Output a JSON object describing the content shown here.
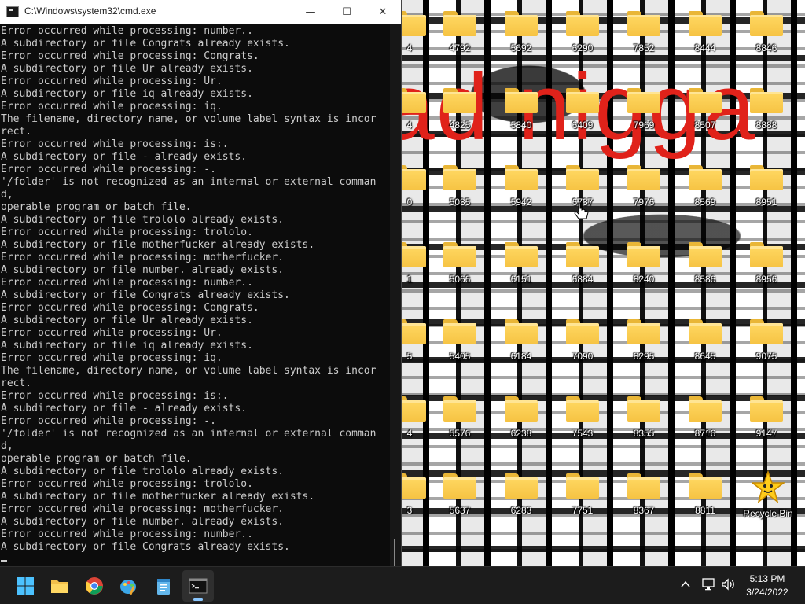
{
  "cmd_window": {
    "title": "C:\\Windows\\system32\\cmd.exe",
    "minimize_symbol": "—",
    "maximize_symbol": "☐",
    "close_symbol": "✕",
    "output_lines": [
      "Error occurred while processing: number..",
      "A subdirectory or file Congrats already exists.",
      "Error occurred while processing: Congrats.",
      "A subdirectory or file Ur already exists.",
      "Error occurred while processing: Ur.",
      "A subdirectory or file iq already exists.",
      "Error occurred while processing: iq.",
      "The filename, directory name, or volume label syntax is incor",
      "rect.",
      "Error occurred while processing: is:.",
      "A subdirectory or file - already exists.",
      "Error occurred while processing: -.",
      "'/folder' is not recognized as an internal or external comman",
      "d,",
      "operable program or batch file.",
      "A subdirectory or file trololo already exists.",
      "Error occurred while processing: trololo.",
      "A subdirectory or file motherfucker already exists.",
      "Error occurred while processing: motherfucker.",
      "A subdirectory or file number. already exists.",
      "Error occurred while processing: number..",
      "A subdirectory or file Congrats already exists.",
      "Error occurred while processing: Congrats.",
      "A subdirectory or file Ur already exists.",
      "Error occurred while processing: Ur.",
      "A subdirectory or file iq already exists.",
      "Error occurred while processing: iq.",
      "The filename, directory name, or volume label syntax is incor",
      "rect.",
      "Error occurred while processing: is:.",
      "A subdirectory or file - already exists.",
      "Error occurred while processing: -.",
      "'/folder' is not recognized as an internal or external comman",
      "d,",
      "operable program or batch file.",
      "A subdirectory or file trololo already exists.",
      "Error occurred while processing: trololo.",
      "A subdirectory or file motherfucker already exists.",
      "Error occurred while processing: motherfucker.",
      "A subdirectory or file number. already exists.",
      "Error occurred while processing: number..",
      "A subdirectory or file Congrats already exists."
    ]
  },
  "desktop": {
    "wallpaper_text": "ad nigga",
    "folder_labels": [
      [
        "4",
        "4792",
        "5692",
        "6290",
        "7852",
        "8444",
        "8846"
      ],
      [
        "4",
        "4825",
        "5840",
        "6409",
        "7969",
        "8507",
        "8888"
      ],
      [
        "0",
        "5035",
        "5942",
        "6737",
        "7976",
        "8569",
        "8951"
      ],
      [
        "1",
        "5066",
        "6151",
        "6884",
        "8240",
        "8586",
        "8956"
      ],
      [
        "5",
        "5405",
        "6184",
        "7090",
        "8295",
        "8645",
        "9075"
      ],
      [
        "4",
        "5576",
        "6238",
        "7543",
        "8355",
        "8716",
        "9147"
      ],
      [
        "3",
        "5637",
        "6283",
        "7751",
        "8367",
        "8811"
      ]
    ],
    "recycle_bin_label": "Recycle Bin"
  },
  "taskbar": {
    "apps": [
      "start-icon",
      "file-explorer-icon",
      "chrome-icon",
      "paint-icon",
      "notepad-icon",
      "cmd-icon"
    ],
    "tray_icons": [
      "chevron-up-icon",
      "network-icon",
      "volume-icon"
    ],
    "time": "5:13 PM",
    "date": "3/24/2022"
  },
  "colors": {
    "console_bg": "#0c0c0c",
    "console_text": "#cccccc",
    "folder_yellow": "#f6c343",
    "wallpaper_text_red": "#e0221a",
    "taskbar_bg": "#1c1c1c"
  }
}
